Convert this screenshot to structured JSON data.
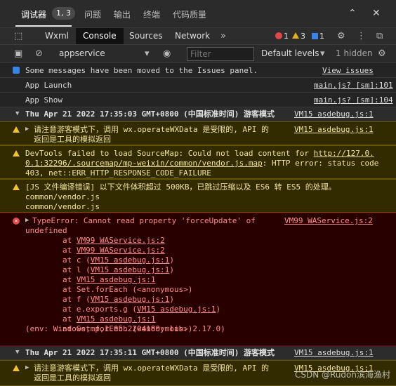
{
  "top_tabs": [
    {
      "label": "调试器",
      "badge": "1, 3"
    },
    {
      "label": "问题"
    },
    {
      "label": "输出"
    },
    {
      "label": "终端"
    },
    {
      "label": "代码质量"
    }
  ],
  "devtools_tabs": [
    "Wxml",
    "Console",
    "Sources",
    "Network"
  ],
  "counts": {
    "errors": "1",
    "warnings": "3",
    "info": "1"
  },
  "filterbar": {
    "context": "appservice",
    "filter_placeholder": "Filter",
    "levels": "Default levels",
    "hidden": "1 hidden"
  },
  "messages": {
    "issues_moved": "Some messages have been moved to the Issues panel.",
    "view_issues": "View issues",
    "app_launch": "App Launch",
    "app_launch_src": "main.js? [sm]:101",
    "app_show": "App Show",
    "app_show_src": "main.js? [sm]:104",
    "group1_time": "Thu Apr 21 2022 17:35:03 GMT+0800 (中国标准时间) 游客模式",
    "group1_src": "VM15 asdebug.js:1",
    "guest_warn_l1": "请注意游客模式下，调用 wx.operateWXData 是受限的, API 的",
    "guest_warn_l2": "返回是工具的模拟返回",
    "guest_warn_src": "VM15 asdebug.js:1",
    "sourcemap_l1": "DevTools failed to load SourceMap: Could not load content for ",
    "sourcemap_link1": "http://127.0.",
    "sourcemap_link2": "0.1:32296/.sourcemap/mp-weixin/common/vendor.js.map",
    "sourcemap_l2_rest": ": HTTP error: status code",
    "sourcemap_l3": "403, net::ERR_HTTP_RESPONSE_CODE_FAILURE",
    "compile_l1": "[JS 文件编译错误] 以下文件体积超过 500KB，已跳过压缩以及 ES6 转 ES5 的处理。",
    "compile_l2": "common/vendor.js",
    "compile_l3": "common/vendor.js",
    "error_l1": "TypeError: Cannot read property 'forceUpdate' of",
    "error_src": "VM99 WAService.js:2",
    "error_l2": "undefined",
    "stack": [
      {
        "prefix": "    at ",
        "link": "VM99 WAService.js:2",
        "suffix": ""
      },
      {
        "prefix": "    at ",
        "link": "VM99 WAService.js:2",
        "suffix": ""
      },
      {
        "prefix": "    at c (",
        "link": "VM15 asdebug.js:1",
        "suffix": ")"
      },
      {
        "prefix": "    at l (",
        "link": "VM15 asdebug.js:1",
        "suffix": ")"
      },
      {
        "prefix": "    at ",
        "link": "VM15 asdebug.js:1",
        "suffix": ""
      },
      {
        "prefix": "    at Set.forEach (<anonymous>)",
        "link": "",
        "suffix": ""
      },
      {
        "prefix": "    at f (",
        "link": "VM15 asdebug.js:1",
        "suffix": ")"
      },
      {
        "prefix": "    at e.exports.g (",
        "link": "VM15 asdebug.js:1",
        "suffix": ")"
      },
      {
        "prefix": "    at ",
        "link": "VM15 asdebug.js:1",
        "suffix": ""
      },
      {
        "prefix": "    at Set.forEach (<anonymous>)",
        "link": "",
        "suffix": ""
      }
    ],
    "env": "(env: Windows,mp,1.05.2204180; lib: 2.17.0)",
    "group2_time": "Thu Apr 21 2022 17:35:11 GMT+0800 (中国标准时间) 游客模式",
    "group2_src": "VM15 asdebug.js:1",
    "guest2_warn_l1": "请注意游客模式下，调用 wx.operateWXData 是受限的, API 的",
    "guest2_warn_l2": "返回是工具的模拟返回",
    "guest2_warn_src": "VM15 asdebug.js:1"
  },
  "watermark": "CSDN @Rudon滨海渔村",
  "colors": {
    "error": "#e04848",
    "warning": "#f1c232",
    "info": "#3a84e6"
  }
}
